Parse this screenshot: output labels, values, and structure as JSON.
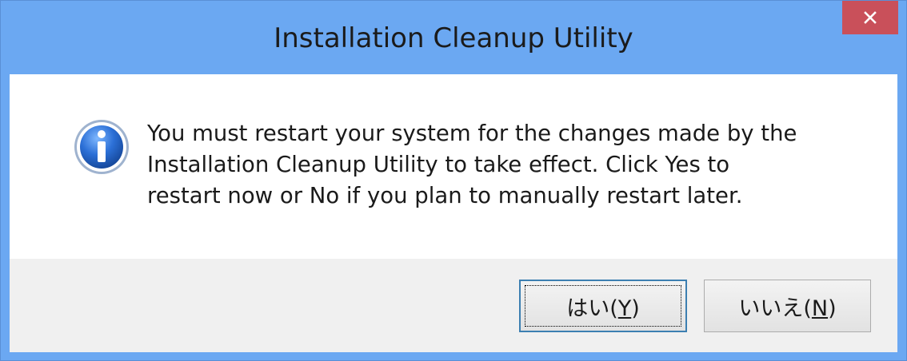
{
  "window": {
    "title": "Installation Cleanup Utility",
    "close_icon": "close-icon"
  },
  "dialog": {
    "icon": "info-icon",
    "message_lines": [
      "You must restart your system for the changes made by the",
      "Installation Cleanup Utility to take effect. Click Yes to",
      "restart now or No if you plan to manually restart later."
    ]
  },
  "buttons": {
    "yes": {
      "label_prefix": "はい(",
      "accel": "Y",
      "label_suffix": ")"
    },
    "no": {
      "label_prefix": "いいえ(",
      "accel": "N",
      "label_suffix": ")"
    }
  },
  "colors": {
    "titlebar": "#6ba8f2",
    "close_button": "#c9505a",
    "footer": "#f0f0f0"
  }
}
